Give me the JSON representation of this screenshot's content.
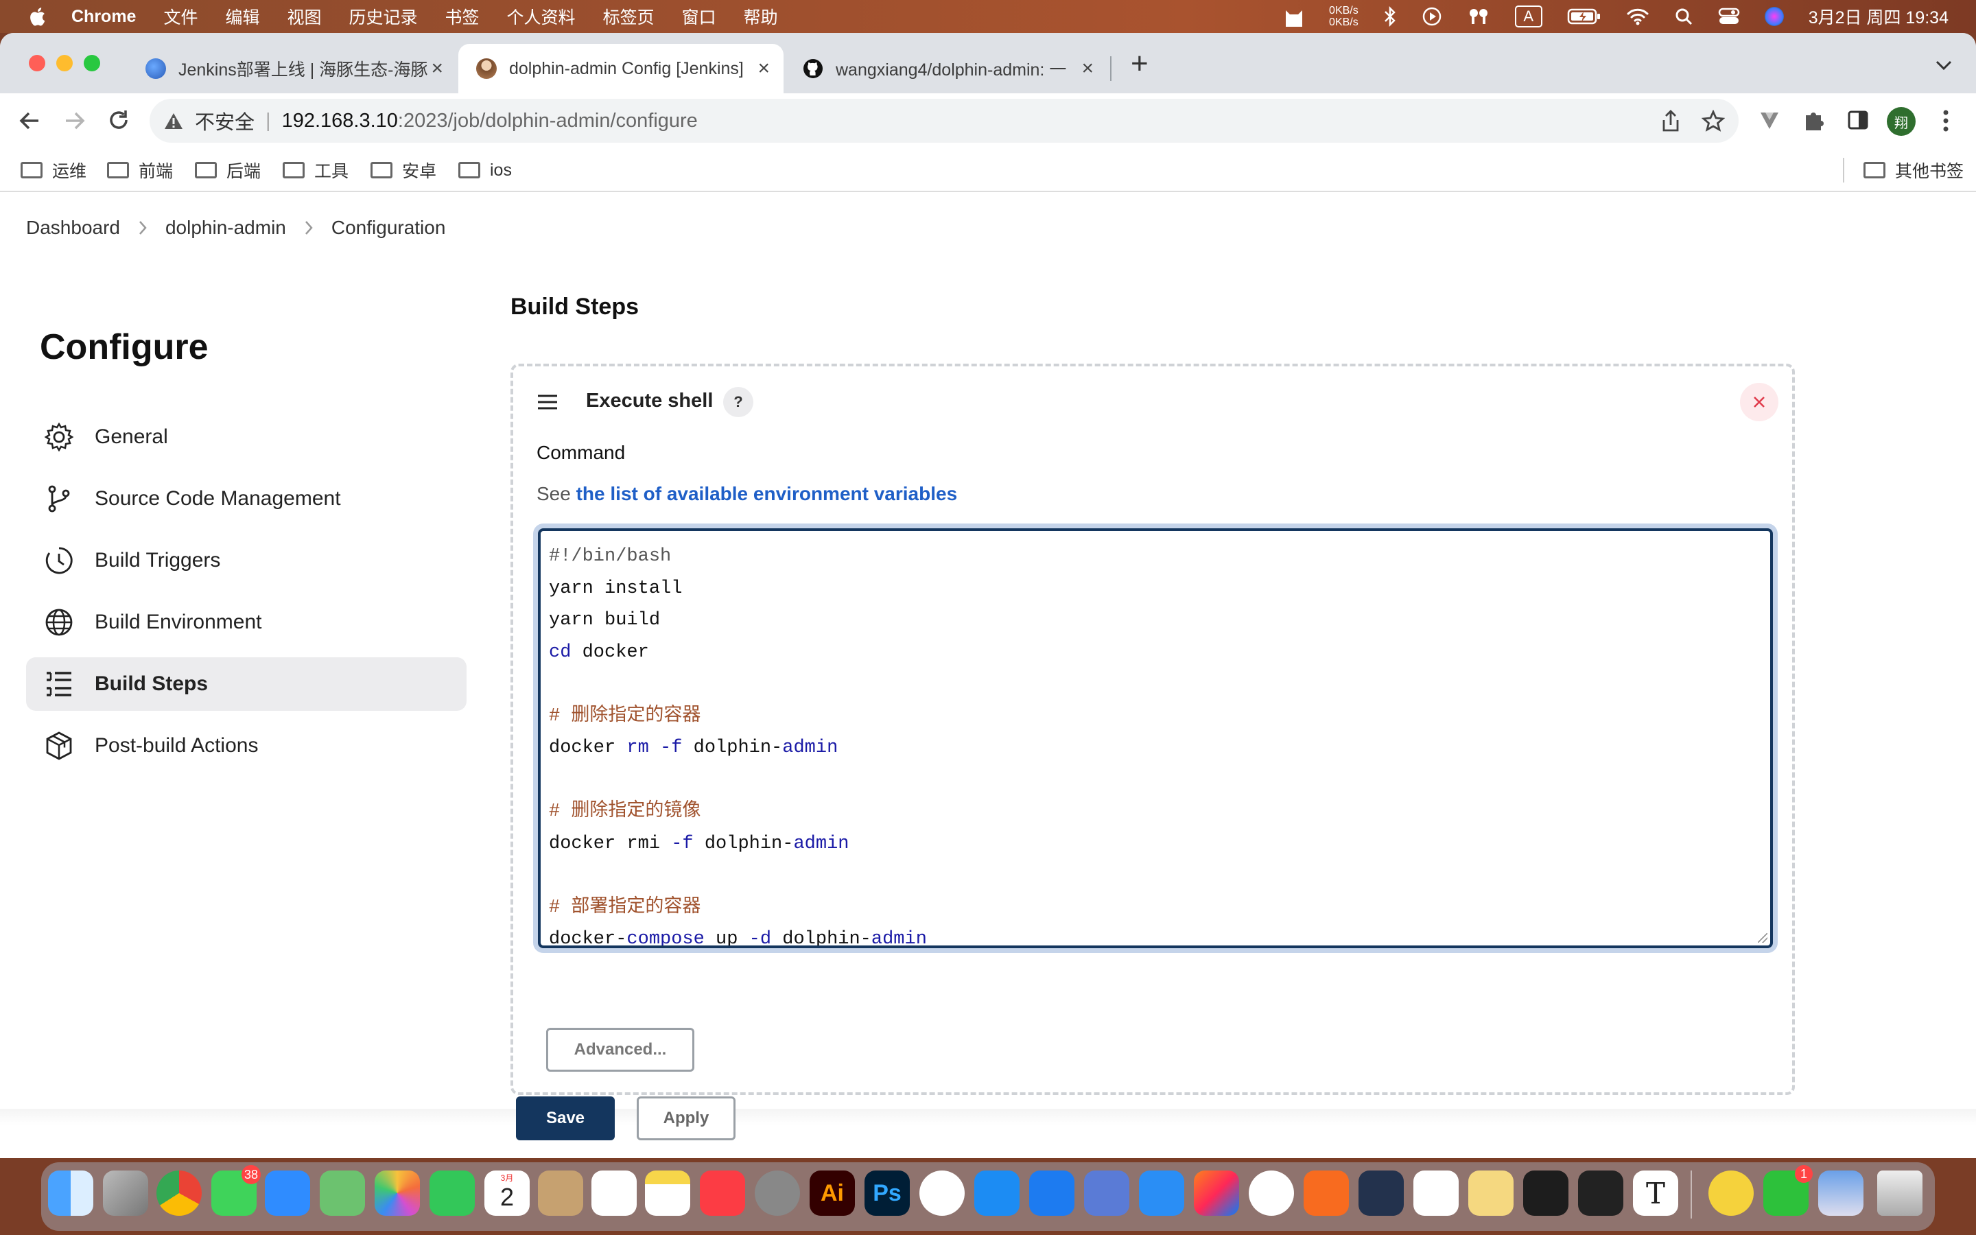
{
  "menubar": {
    "app_name": "Chrome",
    "menus": [
      "文件",
      "编辑",
      "视图",
      "历史记录",
      "书签",
      "个人资料",
      "标签页",
      "窗口",
      "帮助"
    ],
    "net_up": "0KB/s",
    "net_down": "0KB/s",
    "input_method": "A",
    "datetime": "3月2日 周四  19:34"
  },
  "tabs": [
    {
      "title": "Jenkins部署上线 | 海豚生态-海豚",
      "favicon": "jenkins-blog-icon"
    },
    {
      "title": "dolphin-admin Config [Jenkins]",
      "favicon": "jenkins-icon",
      "active": true
    },
    {
      "title": "wangxiang4/dolphin-admin: 一",
      "favicon": "github-icon"
    }
  ],
  "address": {
    "security_label": "不安全",
    "host": "192.168.3.10",
    "path": ":2023/job/dolphin-admin/configure"
  },
  "profile_initial": "翔",
  "bookmarks": [
    "运维",
    "前端",
    "后端",
    "工具",
    "安卓",
    "ios"
  ],
  "other_bookmarks": "其他书签",
  "breadcrumb": [
    "Dashboard",
    "dolphin-admin",
    "Configuration"
  ],
  "page_title": "Configure",
  "sidebar": [
    {
      "label": "General",
      "icon": "gear-icon"
    },
    {
      "label": "Source Code Management",
      "icon": "branch-icon"
    },
    {
      "label": "Build Triggers",
      "icon": "clock-icon"
    },
    {
      "label": "Build Environment",
      "icon": "globe-icon"
    },
    {
      "label": "Build Steps",
      "icon": "list-icon",
      "active": true
    },
    {
      "label": "Post-build Actions",
      "icon": "package-icon"
    }
  ],
  "section_title": "Build Steps",
  "step": {
    "title": "Execute shell",
    "help": "?",
    "command_label": "Command",
    "env_prefix": "See",
    "env_link": "the list of available environment variables",
    "code_lines": [
      "#!/bin/bash",
      "yarn install",
      "yarn build",
      "cd docker",
      "",
      "# 删除指定的容器",
      "docker rm -f dolphin-admin",
      "",
      "# 删除指定的镜像",
      "docker rmi -f dolphin-admin",
      "",
      "# 部署指定的容器",
      "docker-compose up -d dolphin-admin"
    ],
    "advanced_label": "Advanced..."
  },
  "actions": {
    "save": "Save",
    "apply": "Apply"
  },
  "dock": {
    "messages_badge": "38",
    "calendar_month": "3月",
    "calendar_day": "2",
    "wechat_badge": "1"
  },
  "colors": {
    "jenkins_blue": "#14365e",
    "link_blue": "#1f5fc7",
    "close_red": "#e0394a",
    "comment_color": "#a0522d",
    "keyword_color": "#1a1aa6"
  }
}
